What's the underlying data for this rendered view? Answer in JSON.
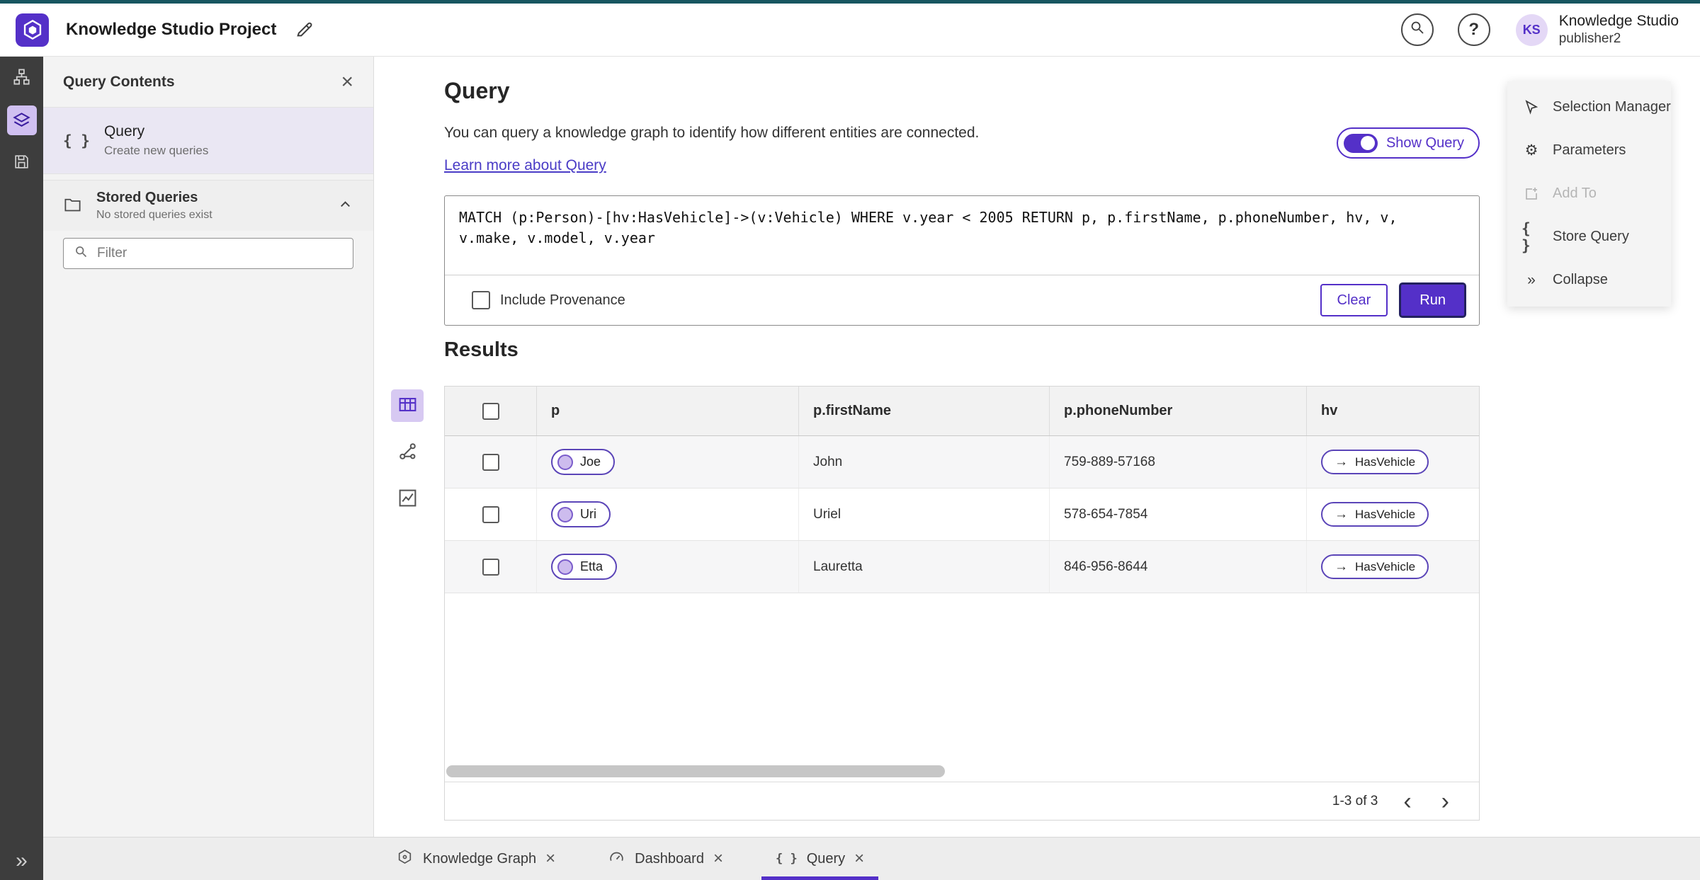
{
  "colors": {
    "accent": "#5430C8",
    "accent_light": "#D7C9F2",
    "rail_bg": "#3D3D3D",
    "sidebar_bg": "#F3F3F3",
    "topline": "#175660"
  },
  "topbar": {
    "title": "Knowledge Studio Project",
    "user_initials": "KS",
    "user_line1": "Knowledge Studio",
    "user_line2": "publisher2"
  },
  "sidebar": {
    "title": "Query Contents",
    "query_item": {
      "title": "Query",
      "subtitle": "Create new queries"
    },
    "stored": {
      "title": "Stored Queries",
      "subtitle": "No stored queries exist"
    },
    "filter_placeholder": "Filter"
  },
  "query_panel": {
    "title": "Query",
    "description": "You can query a knowledge graph to identify how different entities are connected.",
    "learn_more": "Learn more about Query",
    "show_query_label": "Show Query",
    "query_text": "MATCH (p:Person)-[hv:HasVehicle]->(v:Vehicle) WHERE v.year < 2005 RETURN p, p.firstName, p.phoneNumber, hv, v, v.make, v.model, v.year",
    "include_provenance_label": "Include Provenance",
    "clear_label": "Clear",
    "run_label": "Run"
  },
  "results": {
    "title": "Results",
    "columns": [
      "p",
      "p.firstName",
      "p.phoneNumber",
      "hv"
    ],
    "rows": [
      {
        "node": "Joe",
        "first_name": "John",
        "phone": "759-889-57168",
        "edge": "HasVehicle"
      },
      {
        "node": "Uri",
        "first_name": "Uriel",
        "phone": "578-654-7854",
        "edge": "HasVehicle"
      },
      {
        "node": "Etta",
        "first_name": "Lauretta",
        "phone": "846-956-8644",
        "edge": "HasVehicle"
      }
    ],
    "pagination": "1-3 of 3"
  },
  "right_panel": {
    "items": [
      {
        "label": "Selection Manager"
      },
      {
        "label": "Parameters"
      },
      {
        "label": "Add To"
      },
      {
        "label": "Store Query"
      },
      {
        "label": "Collapse"
      }
    ]
  },
  "tabs": [
    {
      "label": "Knowledge Graph"
    },
    {
      "label": "Dashboard"
    },
    {
      "label": "Query"
    }
  ],
  "icons": {
    "close": "×",
    "braces": "{ }",
    "chevrons_right": "»",
    "help": "?",
    "gear": "⚙",
    "arrow_right": "→",
    "chevron_left": "‹",
    "chevron_right": "›"
  }
}
